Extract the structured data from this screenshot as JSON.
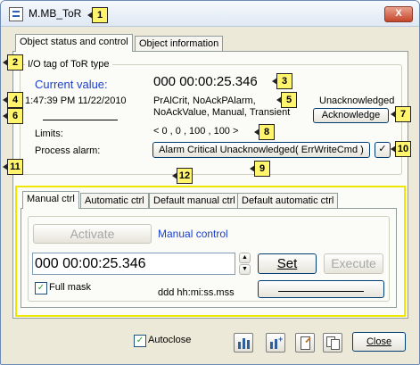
{
  "window": {
    "title": "M.MB_ToR",
    "close_glyph": "X"
  },
  "tabs_top": [
    "Object status and control",
    "Object information"
  ],
  "io_tag_label": "I/O tag of ToR type",
  "current_value_label": "Current value:",
  "current_value": "000 00:00:25.346",
  "timestamp": "1:47:39 PM 11/22/2010",
  "flags_line1": "PrAlCrit, NoAckPAlarm,",
  "flags_line2": "NoAckValue, Manual, Transient",
  "ack_status": "Unacknowledged",
  "acknowledge_button": "Acknowledge",
  "limits_label": "Limits:",
  "limits_value": "< 0 ,  0 ,  100 ,  100 >",
  "process_alarm_label": "Process alarm:",
  "process_alarm_value": "Alarm Critical Unacknowledged( ErrWriteCmd )",
  "control_tabs": [
    "Manual ctrl",
    "Automatic ctrl",
    "Default manual ctrl",
    "Default automatic ctrl"
  ],
  "activate_button": "Activate",
  "mode_label": "Manual control",
  "value_input": "000 00:00:25.346",
  "set_button": "Set",
  "execute_button": "Execute",
  "full_mask_label": "Full mask",
  "format_hint": "ddd hh:mi:ss.mss",
  "autoclose_label": "Autoclose",
  "close_button": "Close",
  "callouts": [
    "1",
    "2",
    "3",
    "4",
    "5",
    "6",
    "7",
    "8",
    "9",
    "10",
    "11",
    "12"
  ],
  "colors": {
    "callout_bg": "#fff46b",
    "link_blue": "#1a3fcf",
    "check_green": "#21a121"
  }
}
